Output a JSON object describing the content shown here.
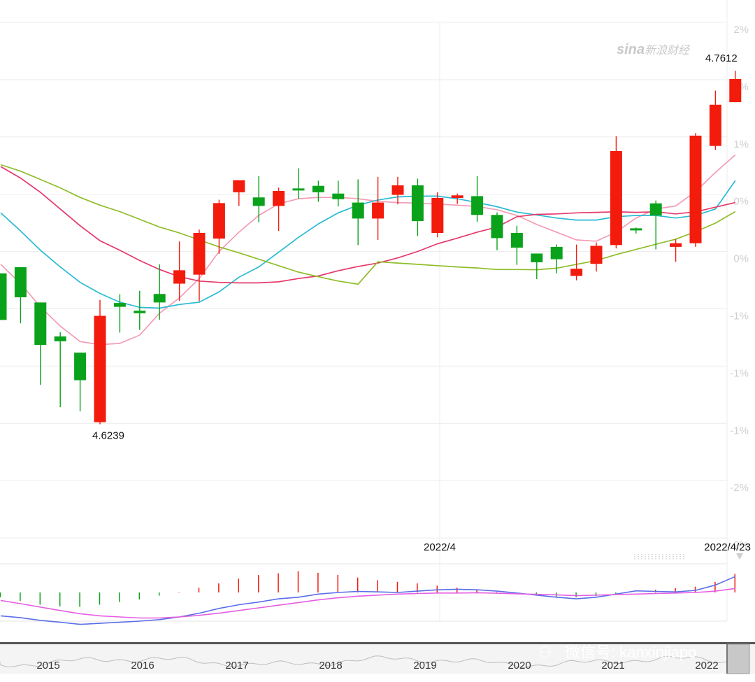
{
  "watermark": {
    "brand": "sina",
    "text": "新浪财经"
  },
  "wechat": {
    "text": "微信号: kanxinjiapo"
  },
  "colors": {
    "up": "#f21b0c",
    "down": "#0ba21b",
    "ma_pink": "#f39cb6",
    "ma_cyan": "#29bbd3",
    "ma_red": "#e5386a",
    "ma_green": "#8fbd2a",
    "macd_dif": "#5b6ee8",
    "macd_dea": "#e45fe3"
  },
  "chart_data": {
    "type": "candlestick",
    "right_axis_labels": [
      "2%",
      "1%",
      "1%",
      "0%",
      "0%",
      "-1%",
      "-1%",
      "-1%",
      "-2%",
      "-2%"
    ],
    "date_labels": [
      "2022/4",
      "2022/4/23"
    ],
    "annotations": [
      {
        "text": "4.6239",
        "kind": "low"
      },
      {
        "text": "4.7612",
        "kind": "high"
      }
    ],
    "price_range": [
      4.58,
      4.78
    ],
    "candles": [
      {
        "o": 4.6825,
        "c": 4.6644,
        "h": 4.6825,
        "l": 4.6644
      },
      {
        "o": 4.6849,
        "c": 4.6732,
        "h": 4.6849,
        "l": 4.6631
      },
      {
        "o": 4.6712,
        "c": 4.6547,
        "h": 4.6712,
        "l": 4.6392
      },
      {
        "o": 4.658,
        "c": 4.6561,
        "h": 4.6596,
        "l": 4.6305
      },
      {
        "o": 4.6517,
        "c": 4.641,
        "h": 4.6517,
        "l": 4.6289
      },
      {
        "o": 4.6247,
        "c": 4.666,
        "h": 4.6722,
        "l": 4.6239
      },
      {
        "o": 4.671,
        "c": 4.6695,
        "h": 4.6744,
        "l": 4.6595
      },
      {
        "o": 4.668,
        "c": 4.667,
        "h": 4.6757,
        "l": 4.6605
      },
      {
        "o": 4.6745,
        "c": 4.6712,
        "h": 4.686,
        "l": 4.6645
      },
      {
        "o": 4.6785,
        "c": 4.6837,
        "h": 4.6949,
        "l": 4.6718
      },
      {
        "o": 4.682,
        "c": 4.6982,
        "h": 4.6995,
        "l": 4.6717
      },
      {
        "o": 4.696,
        "c": 4.7098,
        "h": 4.7111,
        "l": 4.6901
      },
      {
        "o": 4.714,
        "c": 4.7187,
        "h": 4.7187,
        "l": 4.7087
      },
      {
        "o": 4.712,
        "c": 4.7087,
        "h": 4.7203,
        "l": 4.7023
      },
      {
        "o": 4.7087,
        "c": 4.7145,
        "h": 4.7158,
        "l": 4.699
      },
      {
        "o": 4.7155,
        "c": 4.715,
        "h": 4.7233,
        "l": 4.7115
      },
      {
        "o": 4.7165,
        "c": 4.714,
        "h": 4.7185,
        "l": 4.7103
      },
      {
        "o": 4.7135,
        "c": 4.7113,
        "h": 4.7185,
        "l": 4.7085
      },
      {
        "o": 4.71,
        "c": 4.7038,
        "h": 4.719,
        "l": 4.6935
      },
      {
        "o": 4.7038,
        "c": 4.71,
        "h": 4.72,
        "l": 4.6955
      },
      {
        "o": 4.713,
        "c": 4.7167,
        "h": 4.72,
        "l": 4.7093
      },
      {
        "o": 4.7167,
        "c": 4.7028,
        "h": 4.7193,
        "l": 4.697
      },
      {
        "o": 4.6982,
        "c": 4.7118,
        "h": 4.714,
        "l": 4.6965
      },
      {
        "o": 4.7118,
        "c": 4.7128,
        "h": 4.7135,
        "l": 4.7095
      },
      {
        "o": 4.7125,
        "c": 4.7052,
        "h": 4.7203,
        "l": 4.7025
      },
      {
        "o": 4.7052,
        "c": 4.6962,
        "h": 4.7062,
        "l": 4.6915
      },
      {
        "o": 4.6982,
        "c": 4.6925,
        "h": 4.701,
        "l": 4.6858
      },
      {
        "o": 4.6902,
        "c": 4.6868,
        "h": 4.6902,
        "l": 4.6803
      },
      {
        "o": 4.6928,
        "c": 4.688,
        "h": 4.6937,
        "l": 4.6825
      },
      {
        "o": 4.6815,
        "c": 4.6843,
        "h": 4.6937,
        "l": 4.6798
      },
      {
        "o": 4.6862,
        "c": 4.6932,
        "h": 4.6945,
        "l": 4.6832
      },
      {
        "o": 4.6935,
        "c": 4.73,
        "h": 4.7358,
        "l": 4.6922
      },
      {
        "o": 4.7,
        "c": 4.6997,
        "h": 4.7003,
        "l": 4.698
      },
      {
        "o": 4.7097,
        "c": 4.705,
        "h": 4.7108,
        "l": 4.6918
      },
      {
        "o": 4.6928,
        "c": 4.6942,
        "h": 4.6958,
        "l": 4.687
      },
      {
        "o": 4.6942,
        "c": 4.736,
        "h": 4.737,
        "l": 4.6928
      },
      {
        "o": 4.732,
        "c": 4.748,
        "h": 4.7535,
        "l": 4.7305
      },
      {
        "o": 4.749,
        "c": 4.758,
        "h": 4.7612,
        "l": 4.749
      }
    ],
    "ma_lines": [
      {
        "color_key": "ma_pink",
        "values": [
          4.686,
          4.6785,
          4.6695,
          4.662,
          4.656,
          4.6548,
          4.6553,
          4.6585,
          4.667,
          4.673,
          4.6805,
          4.691,
          4.6985,
          4.705,
          4.7095,
          4.7115,
          4.712,
          4.712,
          4.7115,
          4.7105,
          4.71,
          4.7098,
          4.7094,
          4.709,
          4.7085,
          4.7072,
          4.705,
          4.7015,
          4.6985,
          4.6955,
          4.695,
          4.6985,
          4.704,
          4.7075,
          4.7087,
          4.7143,
          4.7217,
          4.7285
        ]
      },
      {
        "color_key": "ma_cyan",
        "values": [
          4.706,
          4.699,
          4.6915,
          4.685,
          4.679,
          4.6747,
          4.6713,
          4.6693,
          4.669,
          4.6704,
          4.6713,
          4.6753,
          4.681,
          4.685,
          4.6907,
          4.6965,
          4.7017,
          4.706,
          4.709,
          4.711,
          4.7122,
          4.7125,
          4.7125,
          4.7115,
          4.71,
          4.7084,
          4.7063,
          4.7052,
          4.704,
          4.7032,
          4.7032,
          4.7045,
          4.705,
          4.705,
          4.704,
          4.705,
          4.7075,
          4.7185
        ]
      },
      {
        "color_key": "ma_red",
        "values": [
          4.724,
          4.7195,
          4.714,
          4.7075,
          4.701,
          4.6952,
          4.6915,
          4.6875,
          4.684,
          4.6812,
          4.6795,
          4.679,
          4.6788,
          4.6788,
          4.6792,
          4.6805,
          4.6815,
          4.6835,
          4.6852,
          4.6865,
          4.6885,
          4.691,
          4.694,
          4.6962,
          4.6985,
          4.7005,
          4.7045,
          4.7054,
          4.7056,
          4.706,
          4.7062,
          4.7064,
          4.7062,
          4.7064,
          4.7056,
          4.7064,
          4.7082,
          4.71
        ]
      },
      {
        "color_key": "ma_green",
        "values": [
          4.7247,
          4.7222,
          4.719,
          4.7157,
          4.712,
          4.709,
          4.7065,
          4.7035,
          4.7005,
          4.6982,
          4.6955,
          4.6928,
          4.6905,
          4.688,
          4.6855,
          4.683,
          4.6812,
          4.6795,
          4.6783,
          4.687,
          4.6865,
          4.686,
          4.6855,
          4.685,
          4.6846,
          4.684,
          4.684,
          4.6839,
          4.6845,
          4.686,
          4.6875,
          4.6898,
          4.6918,
          4.6938,
          4.6958,
          4.6987,
          4.702,
          4.7065
        ]
      }
    ],
    "macd": {
      "bars": [
        -0.18,
        -0.32,
        -0.46,
        -0.52,
        -0.54,
        -0.46,
        -0.36,
        -0.26,
        -0.12,
        0.02,
        0.18,
        0.34,
        0.52,
        0.66,
        0.72,
        0.8,
        0.74,
        0.66,
        0.56,
        0.46,
        0.4,
        0.34,
        0.26,
        0.18,
        0.1,
        0.02,
        -0.06,
        -0.12,
        -0.16,
        -0.18,
        -0.14,
        -0.08,
        0.0,
        0.1,
        0.16,
        0.22,
        0.4,
        0.7
      ],
      "dif": [
        -0.88,
        -0.95,
        -1.05,
        -1.12,
        -1.2,
        -1.16,
        -1.12,
        -1.08,
        -1.02,
        -0.92,
        -0.78,
        -0.6,
        -0.46,
        -0.36,
        -0.24,
        -0.18,
        -0.06,
        0.0,
        0.04,
        0.02,
        0.0,
        0.05,
        0.1,
        0.12,
        0.1,
        0.05,
        -0.02,
        -0.1,
        -0.18,
        -0.24,
        -0.18,
        -0.06,
        0.06,
        0.04,
        0.02,
        0.08,
        0.28,
        0.6
      ],
      "dea": [
        -0.3,
        -0.42,
        -0.55,
        -0.68,
        -0.8,
        -0.88,
        -0.92,
        -0.96,
        -0.96,
        -0.92,
        -0.86,
        -0.78,
        -0.68,
        -0.58,
        -0.48,
        -0.38,
        -0.28,
        -0.2,
        -0.14,
        -0.1,
        -0.06,
        -0.04,
        -0.02,
        -0.02,
        -0.01,
        -0.03,
        -0.05,
        -0.07,
        -0.09,
        -0.12,
        -0.1,
        -0.08,
        -0.06,
        -0.04,
        -0.02,
        0.0,
        0.05,
        0.15
      ]
    },
    "overview_years": [
      "2015",
      "2016",
      "2017",
      "2018",
      "2019",
      "2020",
      "2021",
      "2022"
    ]
  }
}
